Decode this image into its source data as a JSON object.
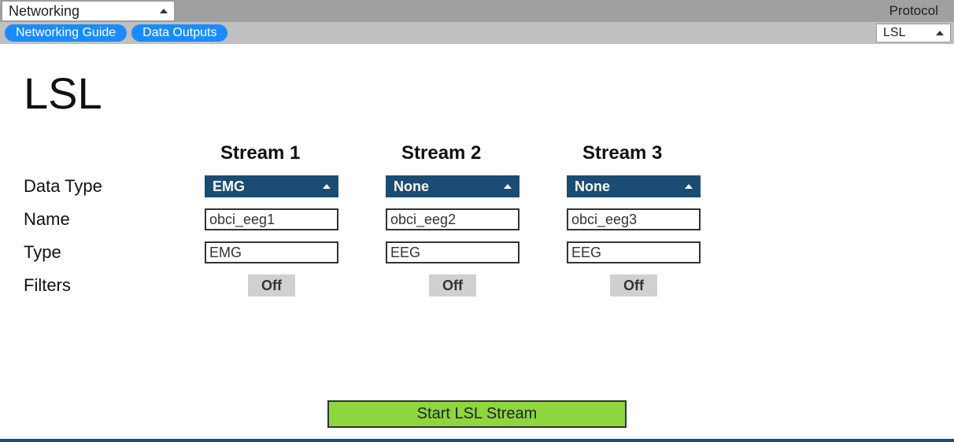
{
  "header": {
    "networking_dropdown": "Networking",
    "protocol_label": "Protocol",
    "protocol_dropdown": "LSL",
    "pills": {
      "networking_guide": "Networking Guide",
      "data_outputs": "Data Outputs"
    }
  },
  "page": {
    "title": "LSL"
  },
  "row_labels": {
    "data_type": "Data Type",
    "name": "Name",
    "type": "Type",
    "filters": "Filters"
  },
  "streams": [
    {
      "header": "Stream 1",
      "data_type": "EMG",
      "name": "obci_eeg1",
      "type": "EMG",
      "filters": "Off"
    },
    {
      "header": "Stream 2",
      "data_type": "None",
      "name": "obci_eeg2",
      "type": "EEG",
      "filters": "Off"
    },
    {
      "header": "Stream 3",
      "data_type": "None",
      "name": "obci_eeg3",
      "type": "EEG",
      "filters": "Off"
    }
  ],
  "actions": {
    "start_button": "Start LSL Stream"
  },
  "colors": {
    "accent_dark_blue": "#1b4c74",
    "pill_blue": "#1a8cff",
    "start_green": "#8ed63e",
    "toggle_grey": "#d0d0d0"
  }
}
